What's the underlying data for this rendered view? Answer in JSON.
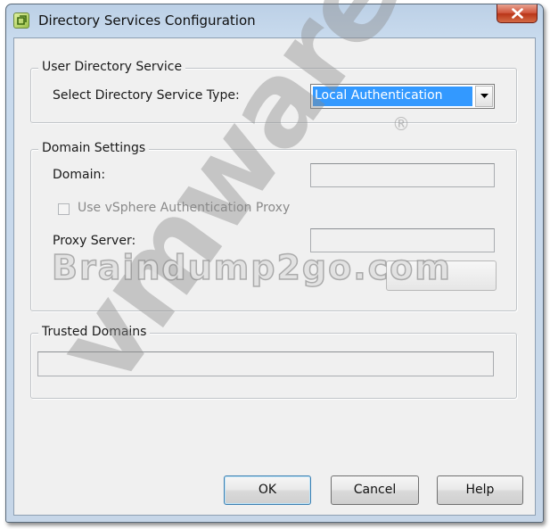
{
  "window": {
    "title": "Directory Services Configuration"
  },
  "user_directory_service": {
    "group_label": "User Directory Service",
    "type_label": "Select Directory Service Type:",
    "type_value": "Local Authentication"
  },
  "domain_settings": {
    "group_label": "Domain Settings",
    "domain_label": "Domain:",
    "domain_value": "",
    "proxy_checkbox_label": "Use vSphere Authentication Proxy",
    "proxy_checkbox_checked": false,
    "proxy_server_label": "Proxy Server:",
    "proxy_server_value": ""
  },
  "trusted_domains": {
    "group_label": "Trusted Domains"
  },
  "buttons": {
    "ok": "OK",
    "cancel": "Cancel",
    "help": "Help"
  },
  "watermarks": {
    "site_text": "Braindump2go.com",
    "logo_text": "vmware",
    "registered_mark": "®"
  },
  "colors": {
    "selection": "#3399ff",
    "title_bar": "#c9dbee",
    "close_button": "#c94a2c",
    "client_bg": "#f0f0f0"
  },
  "icons": {
    "app": "vsphere-app-icon",
    "close": "close-icon",
    "dropdown": "chevron-down-icon"
  }
}
